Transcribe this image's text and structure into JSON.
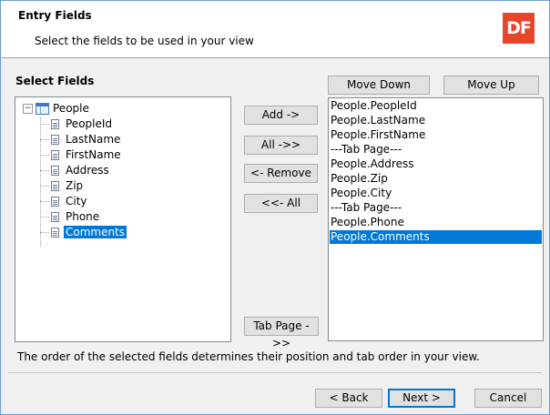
{
  "header": {
    "title": "Entry Fields",
    "subtitle": "Select the fields to be used in your view",
    "logo_text": "DF",
    "logo_color": "#e8462a"
  },
  "select_fields": {
    "label": "Select Fields",
    "root": {
      "icon": "table-icon",
      "label": "People",
      "expander": "−"
    },
    "items": [
      {
        "label": "PeopleId"
      },
      {
        "label": "LastName"
      },
      {
        "label": "FirstName"
      },
      {
        "label": "Address"
      },
      {
        "label": "Zip"
      },
      {
        "label": "City"
      },
      {
        "label": "Phone"
      },
      {
        "label": "Comments",
        "selected": true
      }
    ]
  },
  "middle_buttons": {
    "add": "Add ->",
    "all": "All ->>",
    "remove": "<- Remove",
    "remove_all": "<<- All",
    "tab_page": "Tab Page ->>"
  },
  "order_buttons": {
    "move_down": "Move Down",
    "move_up": "Move Up"
  },
  "selected_list": {
    "items": [
      {
        "label": "People.PeopleId"
      },
      {
        "label": "People.LastName"
      },
      {
        "label": "People.FirstName"
      },
      {
        "label": "---Tab Page---"
      },
      {
        "label": "People.Address"
      },
      {
        "label": "People.Zip"
      },
      {
        "label": "People.City"
      },
      {
        "label": "---Tab Page---"
      },
      {
        "label": "People.Phone"
      },
      {
        "label": "People.Comments",
        "selected": true
      }
    ]
  },
  "info_text": "The order of the selected fields determines their position and tab order in your view.",
  "footer": {
    "back": "< Back",
    "next": "Next >",
    "cancel": "Cancel"
  },
  "colors": {
    "selection": "#0078d7",
    "accent": "#e8462a"
  }
}
